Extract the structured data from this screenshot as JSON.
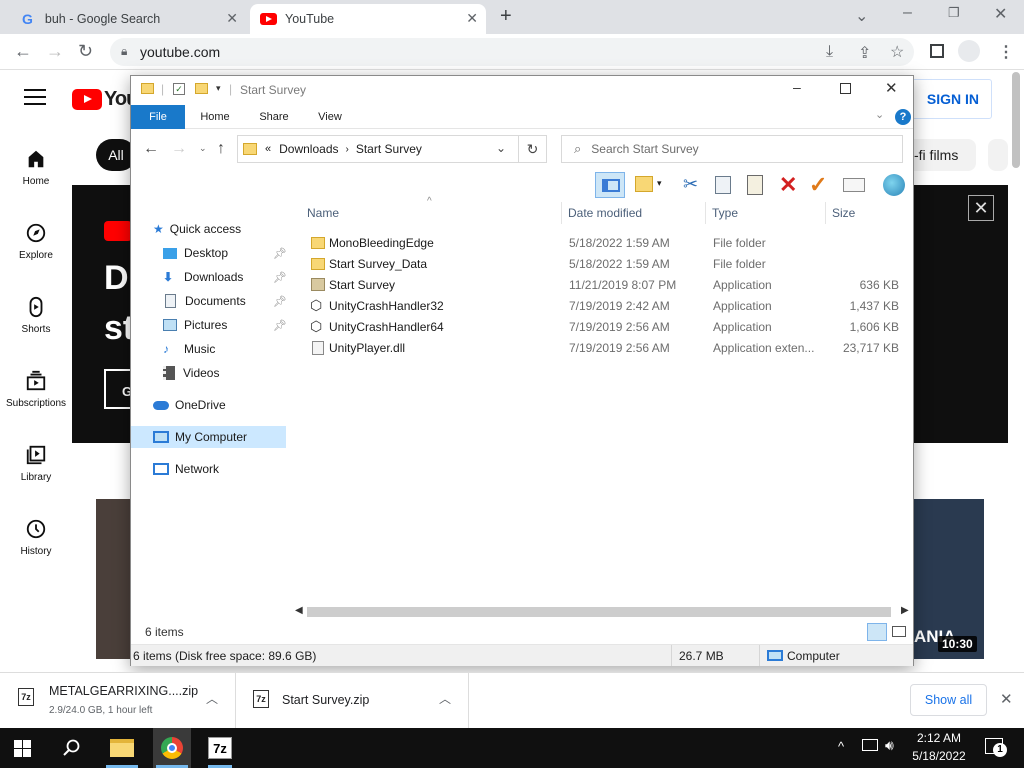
{
  "browser": {
    "tabs": [
      {
        "title": "buh - Google Search",
        "icon": "google-g-icon"
      },
      {
        "title": "YouTube",
        "icon": "youtube-icon"
      }
    ],
    "url": "youtube.com"
  },
  "youtube": {
    "logo_text": "You",
    "sign_in": "SIGN IN",
    "chip_all": "All",
    "chip_films": "-fi films",
    "sidebar": [
      {
        "label": "Home",
        "icon": "home-icon"
      },
      {
        "label": "Explore",
        "icon": "compass-icon"
      },
      {
        "label": "Shorts",
        "icon": "shorts-icon"
      },
      {
        "label": "Subscriptions",
        "icon": "subscriptions-icon"
      },
      {
        "label": "Library",
        "icon": "library-icon"
      },
      {
        "label": "History",
        "icon": "history-icon"
      }
    ],
    "hero_text1": "D",
    "hero_text2": "st",
    "hero_btn": "G",
    "video_badge": "ANIA",
    "video_duration": "10:30"
  },
  "explorer": {
    "title": "Start Survey",
    "ribbon_tabs": [
      "File",
      "Home",
      "Share",
      "View"
    ],
    "address": {
      "root": "Downloads",
      "current": "Start Survey"
    },
    "search_placeholder": "Search Start Survey",
    "nav": [
      {
        "label": "Quick access",
        "icon": "star-icon"
      },
      {
        "label": "Desktop",
        "icon": "desktop-icon"
      },
      {
        "label": "Downloads",
        "icon": "downloads-icon"
      },
      {
        "label": "Documents",
        "icon": "documents-icon"
      },
      {
        "label": "Pictures",
        "icon": "pictures-icon"
      },
      {
        "label": "Music",
        "icon": "music-icon"
      },
      {
        "label": "Videos",
        "icon": "videos-icon"
      },
      {
        "label": "OneDrive",
        "icon": "cloud-icon"
      },
      {
        "label": "My Computer",
        "icon": "computer-icon"
      },
      {
        "label": "Network",
        "icon": "network-icon"
      }
    ],
    "columns": [
      "Name",
      "Date modified",
      "Type",
      "Size"
    ],
    "files": [
      {
        "name": "MonoBleedingEdge",
        "date": "5/18/2022 1:59 AM",
        "type": "File folder",
        "size": "",
        "icon": "folder-icon"
      },
      {
        "name": "Start Survey_Data",
        "date": "5/18/2022 1:59 AM",
        "type": "File folder",
        "size": "",
        "icon": "folder-icon"
      },
      {
        "name": "Start Survey",
        "date": "11/21/2019 8:07 PM",
        "type": "Application",
        "size": "636 KB",
        "icon": "app-icon"
      },
      {
        "name": "UnityCrashHandler32",
        "date": "7/19/2019 2:42 AM",
        "type": "Application",
        "size": "1,437 KB",
        "icon": "unity-icon"
      },
      {
        "name": "UnityCrashHandler64",
        "date": "7/19/2019 2:56 AM",
        "type": "Application",
        "size": "1,606 KB",
        "icon": "unity-icon"
      },
      {
        "name": "UnityPlayer.dll",
        "date": "7/19/2019 2:56 AM",
        "type": "Application exten...",
        "size": "23,717 KB",
        "icon": "dll-icon"
      }
    ],
    "item_count": "6 items",
    "status_left": "6 items (Disk free space: 89.6 GB)",
    "status_size": "26.7 MB",
    "status_location": "Computer"
  },
  "downloads": [
    {
      "name": "METALGEARRIXING....zip",
      "detail": "2.9/24.0 GB, 1 hour left"
    },
    {
      "name": "Start Survey.zip",
      "detail": ""
    }
  ],
  "show_all": "Show all",
  "taskbar": {
    "time": "2:12 AM",
    "date": "5/18/2022",
    "notifications": "1"
  }
}
